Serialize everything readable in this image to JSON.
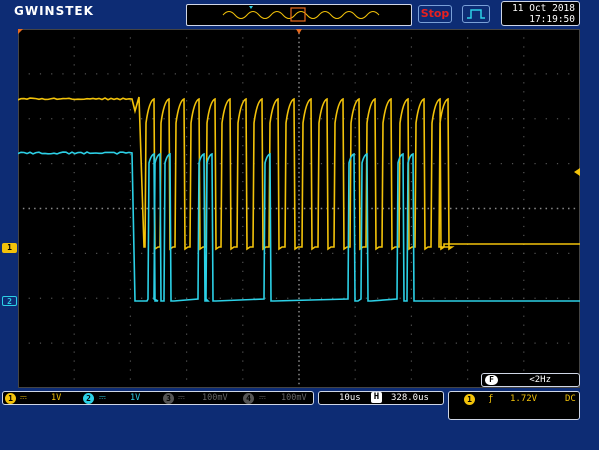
{
  "header": {
    "brand": "GWINSTEK",
    "run_state": "Stop",
    "trigger_mode_icon": "trigger-pulse-icon",
    "date": "11 Oct 2018",
    "time": "17:19:50"
  },
  "screen": {
    "ch1_marker": "1",
    "ch2_marker": "2",
    "frequency": {
      "label": "F",
      "value": "<2Hz"
    }
  },
  "channels": [
    {
      "num": "1",
      "coupling": "DC",
      "scale": "1V",
      "color": "#f2c20a",
      "active": true
    },
    {
      "num": "2",
      "coupling": "DC",
      "scale": "1V",
      "color": "#2cd0e6",
      "active": true
    },
    {
      "num": "3",
      "coupling": "DC",
      "scale": "100mV",
      "color": "#555555",
      "active": false
    },
    {
      "num": "4",
      "coupling": "DC",
      "scale": "100mV",
      "color": "#555555",
      "active": false
    }
  ],
  "timebase": {
    "scale": "10us",
    "h_label": "H",
    "position": "328.0us"
  },
  "trigger": {
    "source": "1",
    "slope_icon": "rising-edge-icon",
    "level": "1.72V",
    "coupling": "DC"
  },
  "colors": {
    "ch1": "#f2c20a",
    "ch2": "#2cd0e6",
    "frame": "#0d2c74",
    "grid": "#555555"
  }
}
